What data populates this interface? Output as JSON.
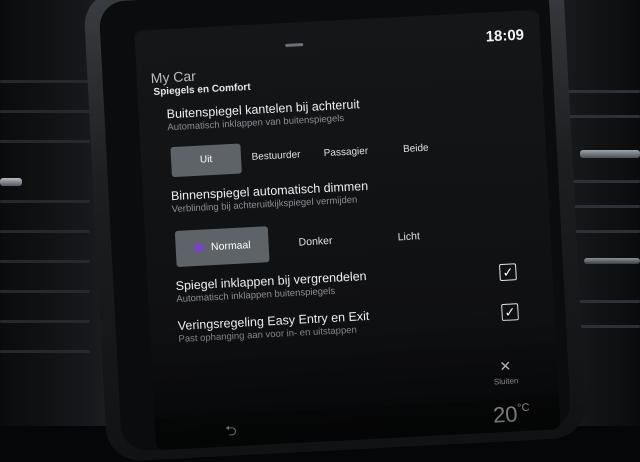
{
  "status": {
    "clock": "18:09",
    "temperature": "20",
    "temperature_unit": "°C"
  },
  "header": {
    "app_title": "My Car",
    "page_title": "Spiegels en Comfort"
  },
  "settings": {
    "mirror_tilt": {
      "title": "Buitenspiegel kantelen bij achteruit",
      "description": "Automatisch inklappen van buitenspiegels",
      "options": [
        "Uit",
        "Bestuurder",
        "Passagier",
        "Beide"
      ],
      "selected": "Uit"
    },
    "auto_dim": {
      "title": "Binnenspiegel automatisch dimmen",
      "description": "Verblinding bij achteruitkijkspiegel vermijden",
      "options": [
        "Normaal",
        "Donker",
        "Licht"
      ],
      "selected": "Normaal",
      "selected_color": "#7b3fcf"
    },
    "fold_on_lock": {
      "title": "Spiegel inklappen bij vergrendelen",
      "description": "Automatisch inklappen buitenspiegels",
      "checked": true
    },
    "easy_entry": {
      "title": "Veringsregeling Easy Entry en Exit",
      "description": "Past ophanging aan voor in- en uitstappen",
      "checked": true
    }
  },
  "footer": {
    "close_label": "Sluiten",
    "close_icon": "close-icon",
    "back_icon": "back-icon"
  }
}
